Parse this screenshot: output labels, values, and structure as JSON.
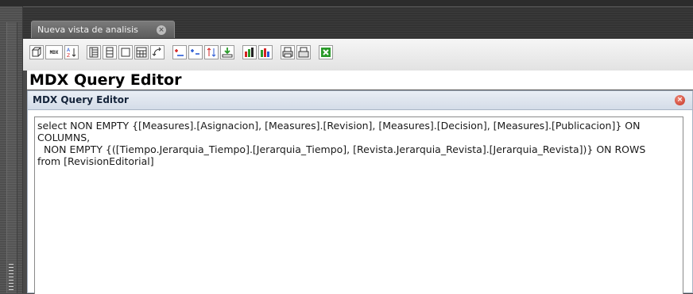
{
  "tab": {
    "label": "Nueva vista de analisis",
    "close_glyph": "×"
  },
  "toolbar": {
    "buttons": [
      {
        "name": "cube-icon"
      },
      {
        "name": "mdx-icon",
        "label": "MDX"
      },
      {
        "name": "sort-az-icon",
        "label": "A↓Z"
      },
      {
        "name": "layout-columns-icon"
      },
      {
        "name": "layout-rows-icon"
      },
      {
        "name": "blank-layout-icon"
      },
      {
        "name": "table-grid-icon"
      },
      {
        "name": "swap-axes-icon"
      },
      {
        "name": "drill-plus-icon"
      },
      {
        "name": "drill-minus-icon"
      },
      {
        "name": "drill-arrows-icon"
      },
      {
        "name": "drill-down-green-icon"
      },
      {
        "name": "chart-icon"
      },
      {
        "name": "chart-settings-icon"
      },
      {
        "name": "print-icon"
      },
      {
        "name": "print-setup-icon"
      },
      {
        "name": "excel-export-icon"
      }
    ],
    "colors": {
      "red": "#d42020",
      "green": "#2a9a2a",
      "blue": "#2a5ad4"
    }
  },
  "heading": "MDX Query Editor",
  "panel": {
    "title": "MDX Query Editor",
    "close_glyph": "×",
    "query": "select NON EMPTY {[Measures].[Asignacion], [Measures].[Revision], [Measures].[Decision], [Measures].[Publicacion]} ON COLUMNS,\n  NON EMPTY {([Tiempo.Jerarquia_Tiempo].[Jerarquia_Tiempo], [Revista.Jerarquia_Revista].[Jerarquia_Revista])} ON ROWS\nfrom [RevisionEditorial]"
  }
}
